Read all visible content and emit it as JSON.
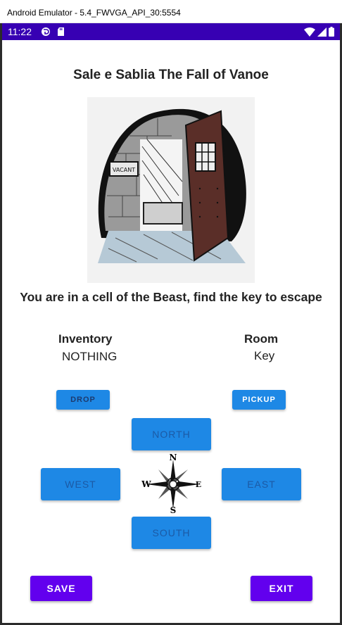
{
  "window": {
    "title": "Android Emulator - 5.4_FWVGA_API_30:5554"
  },
  "status_bar": {
    "time": "11:22",
    "left_icons": [
      "game-notification-icon",
      "sd-card-icon"
    ],
    "right_icons": [
      "wifi-icon",
      "signal-icon",
      "battery-icon"
    ]
  },
  "app": {
    "title": "Sale e Sablia The Fall of Vanoe",
    "message": "You are in a cell of the Beast, find the key to escape",
    "scene_image": "prison-cell-open-door-illustration",
    "inventory": {
      "label": "Inventory",
      "value": "NOTHING"
    },
    "room": {
      "label": "Room",
      "value": "Key"
    },
    "buttons": {
      "drop": "DROP",
      "pickup": "PICKUP",
      "north": "NORTH",
      "south": "SOUTH",
      "east": "EAST",
      "west": "WEST",
      "save": "SAVE",
      "exit": "EXIT"
    },
    "compass": {
      "n": "N",
      "s": "S",
      "e": "E",
      "w": "W"
    },
    "colors": {
      "status_bar": "#3700b3",
      "action_button": "#1e88e5",
      "primary_button": "#6200ee"
    }
  }
}
